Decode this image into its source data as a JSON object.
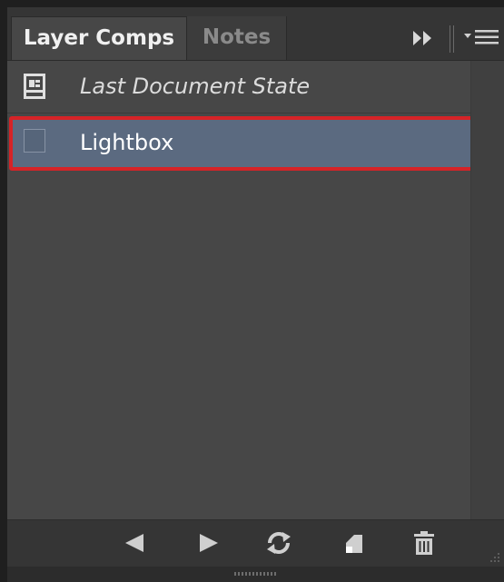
{
  "panel": {
    "tabs": [
      {
        "label": "Layer Comps",
        "active": true
      },
      {
        "label": "Notes",
        "active": false
      }
    ],
    "icons": {
      "collapse": "double-chevron-right-icon",
      "menu": "panel-menu-icon"
    }
  },
  "list": {
    "items": [
      {
        "label": "Last Document State",
        "icon": "document-state-icon",
        "italic": true,
        "selected": false
      },
      {
        "label": "Lightbox",
        "icon": "comp-swatch-icon",
        "italic": false,
        "selected": true
      }
    ]
  },
  "toolbar": {
    "buttons": [
      {
        "icon": "previous-arrow-icon",
        "action": "previous"
      },
      {
        "icon": "next-arrow-icon",
        "action": "next"
      },
      {
        "icon": "update-refresh-icon",
        "action": "update"
      },
      {
        "icon": "new-comp-icon",
        "action": "new"
      },
      {
        "icon": "trash-icon",
        "action": "delete"
      }
    ]
  },
  "colors": {
    "panel_bg": "#474747",
    "selection_bg": "#5b6a80",
    "highlight_border": "#d62327",
    "text": "#e8e8e8"
  }
}
